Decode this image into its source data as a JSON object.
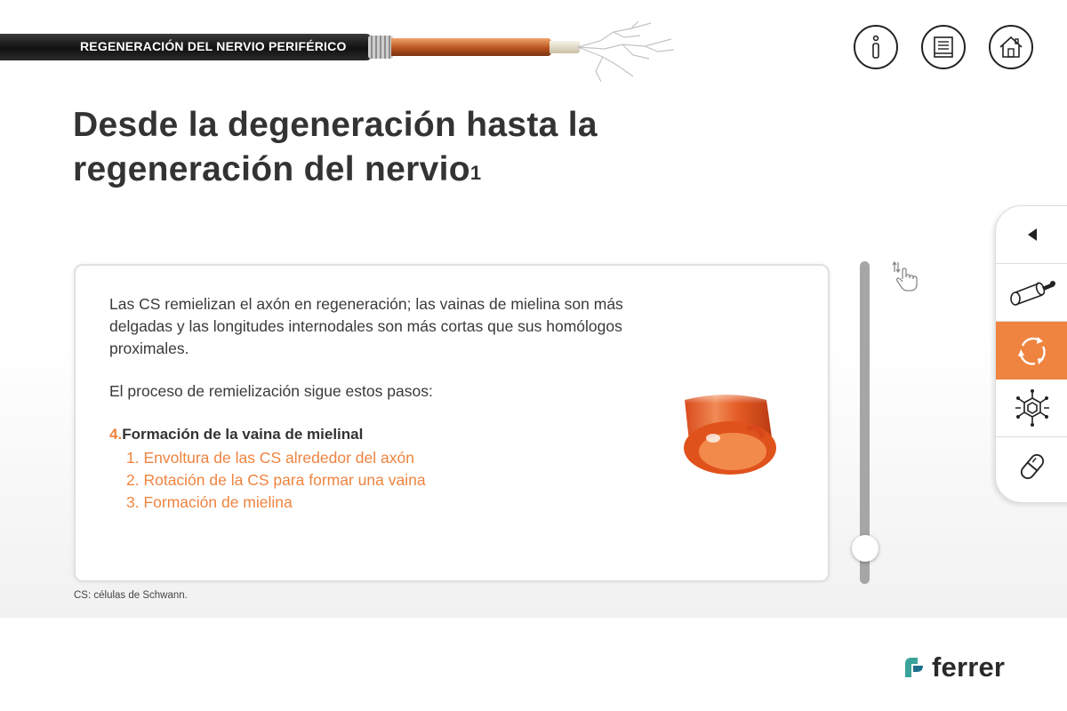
{
  "header": {
    "section_title": "REGENERACIÓN DEL NERVIO PERIFÉRICO",
    "icons": [
      "info-icon",
      "book-icon",
      "home-icon"
    ]
  },
  "main": {
    "title_line1": "Desde la degeneración hasta la",
    "title_line2": "regeneración del nervio",
    "title_sup": "1",
    "paragraph1": "Las CS remielizan el axón en regeneración; las vainas de mielina son más delgadas y las longitudes internodales son más cortas que sus homólogos proximales.",
    "paragraph2": "El proceso de remielización sigue estos pasos:",
    "step_number": "4.",
    "step_title": "Formación de la vaina de mielinal",
    "substeps": [
      "1. Envoltura de las CS alrededor del axón",
      "2. Rotación de la CS para formar una vaina",
      "3. Formación de mielina"
    ]
  },
  "footnote": "CS: células de Schwann.",
  "side_nav": {
    "items": [
      "back-arrow-icon",
      "nerve-cable-icon",
      "cycle-arrows-icon",
      "molecule-icon",
      "capsule-icon"
    ],
    "active_index": 2
  },
  "scroll": {
    "position": 0.9
  },
  "logo": {
    "text": "ferrer"
  },
  "colors": {
    "accent": "#ee8440",
    "text": "#333333",
    "cable": "#1a1a1a",
    "copper": "#c0602a"
  }
}
